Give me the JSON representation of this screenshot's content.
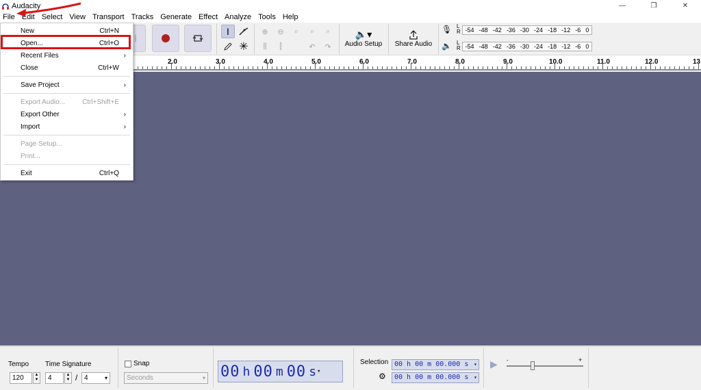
{
  "window": {
    "title": "Audacity",
    "minimize": "—",
    "restore": "❐",
    "close": "✕"
  },
  "menubar": [
    "File",
    "Edit",
    "Select",
    "View",
    "Transport",
    "Tracks",
    "Generate",
    "Effect",
    "Analyze",
    "Tools",
    "Help"
  ],
  "toolbar": {
    "audio_setup": "Audio Setup",
    "share_audio": "Share Audio",
    "meter_labels": {
      "left": "L",
      "right": "R"
    },
    "meter_ticks": [
      "-54",
      "-48",
      "-42",
      "-36",
      "-30",
      "-24",
      "-18",
      "-12",
      "-6",
      "0"
    ]
  },
  "ruler": {
    "ticks": [
      "2.0",
      "3.0",
      "4.0",
      "5.0",
      "6.0",
      "7.0",
      "8.0",
      "9.0",
      "10.0",
      "11.0",
      "12.0",
      "13"
    ]
  },
  "file_menu": {
    "items": [
      {
        "label": "New",
        "shortcut": "Ctrl+N"
      },
      {
        "label": "Open...",
        "shortcut": "Ctrl+O"
      },
      {
        "label": "Recent Files",
        "submenu": "›"
      },
      {
        "label": "Close",
        "shortcut": "Ctrl+W"
      },
      {
        "label": "Save Project",
        "submenu": "›"
      },
      {
        "label": "Export Audio...",
        "shortcut": "Ctrl+Shift+E"
      },
      {
        "label": "Export Other",
        "submenu": "›"
      },
      {
        "label": "Import",
        "submenu": "›"
      },
      {
        "label": "Page Setup..."
      },
      {
        "label": "Print..."
      },
      {
        "label": "Exit",
        "shortcut": "Ctrl+Q"
      }
    ]
  },
  "bottom": {
    "tempo_label": "Tempo",
    "tempo_value": "120",
    "time_sig_label": "Time Signature",
    "time_sig_num": "4",
    "time_sig_slash": "/",
    "time_sig_den": "4",
    "snap_label": "Snap",
    "snap_unit": "Seconds",
    "time": {
      "h": "00",
      "h_unit": "h",
      "m": "00",
      "m_unit": "m",
      "s": "00",
      "s_unit": "s"
    },
    "selection_label": "Selection",
    "selection_start": "00 h 00 m 00.000 s",
    "selection_end": "00 h 00 m 00.000 s"
  },
  "colors": {
    "track_bg": "#5f6180",
    "highlight": "#d81414",
    "time_text": "#1b2ba8",
    "record": "#b02020"
  }
}
